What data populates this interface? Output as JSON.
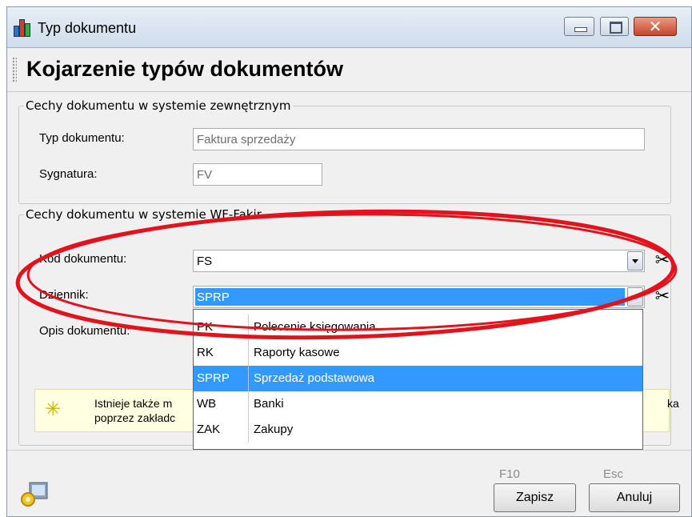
{
  "window": {
    "title": "Typ dokumentu",
    "controls": {
      "minimize": "minimize",
      "maximize": "maximize",
      "close": "✕"
    }
  },
  "header": {
    "title": "Kojarzenie typów dokumentów"
  },
  "external_group": {
    "legend": "Cechy dokumentu w systemie zewnętrznym",
    "doc_type_label": "Typ dokumentu:",
    "doc_type_value": "Faktura sprzedaży",
    "signature_label": "Sygnatura:",
    "signature_value": "FV"
  },
  "wfmag_group": {
    "legend": "Cechy dokumentu w systemie WF-Fakir",
    "code_label": "Kod dokumentu:",
    "code_value": "FS",
    "journal_label": "Dziennik:",
    "journal_value": "SPRP",
    "description_label": "Opis dokumentu:"
  },
  "journal_options": [
    {
      "code": "PK",
      "name": "Polecenie księgowania"
    },
    {
      "code": "RK",
      "name": "Raporty kasowe"
    },
    {
      "code": "SPRP",
      "name": "Sprzedaż podstawowa"
    },
    {
      "code": "WB",
      "name": "Banki"
    },
    {
      "code": "ZAK",
      "name": "Zakupy"
    }
  ],
  "hint": {
    "line1": "Istnieje także m",
    "line2": "poprzez zakładc",
    "tail": "ka"
  },
  "footer": {
    "save_key": "F10",
    "save_label": "Zapisz",
    "cancel_key": "Esc",
    "cancel_label": "Anuluj"
  },
  "colors": {
    "selection": "#3399ff",
    "annotation": "#e2131d",
    "hint_background": "#ffffe1"
  },
  "icons": {
    "app": "chart-bars-icon",
    "clear": "scissors-icon",
    "hint": "click-cursor-icon",
    "config": "gear-computer-icon"
  }
}
